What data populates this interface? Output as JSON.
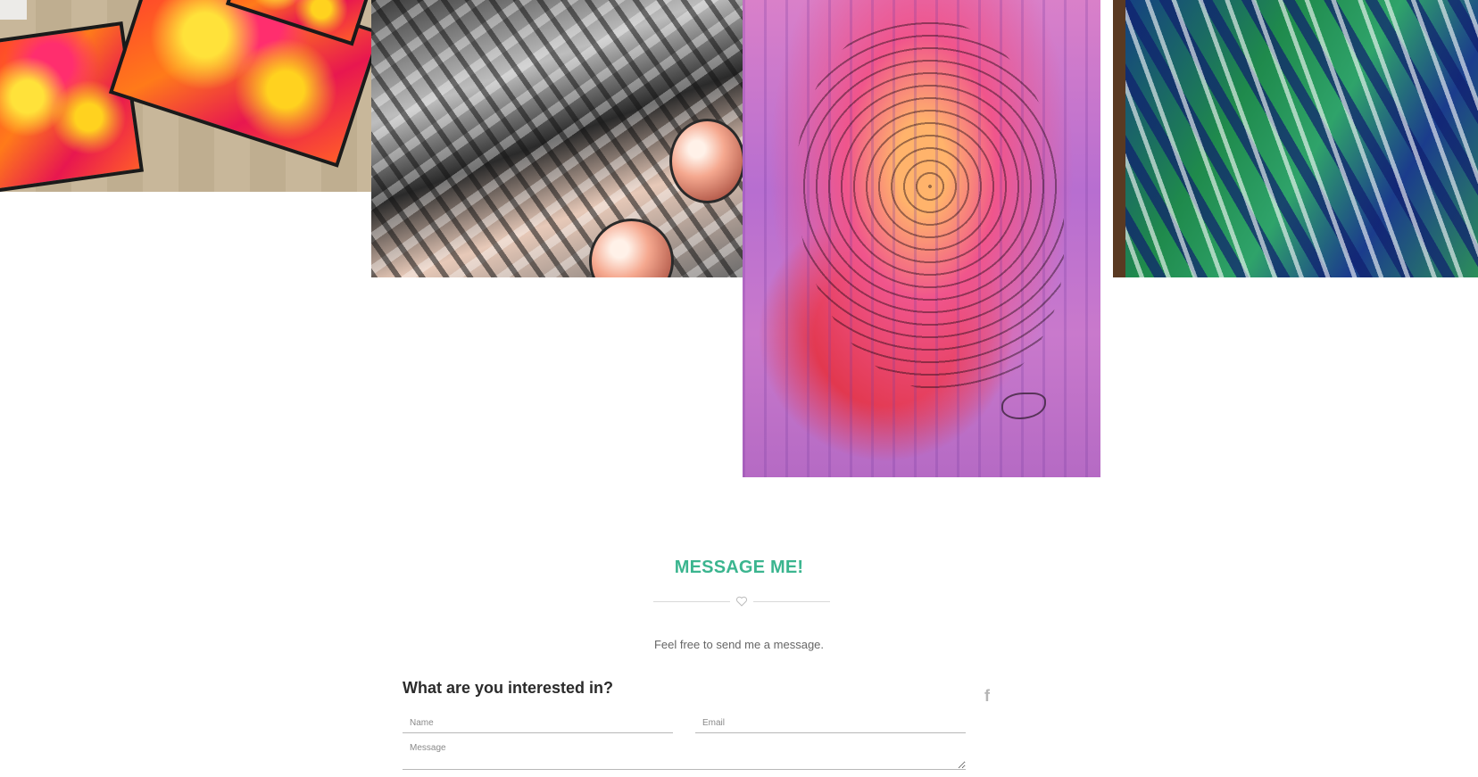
{
  "gallery": {
    "items": [
      {
        "name": "artwork-fiery-canvases"
      },
      {
        "name": "artwork-grey-spheres"
      },
      {
        "name": "artwork-purple-ink"
      },
      {
        "name": "artwork-green-brush"
      }
    ]
  },
  "contact": {
    "title": "MESSAGE ME!",
    "subtitle": "Feel free to send me a message.",
    "form_heading": "What are you interested in?",
    "name_placeholder": "Name",
    "email_placeholder": "Email",
    "message_placeholder": "Message",
    "social_icon": "f",
    "accent_color": "#3bb58f"
  }
}
